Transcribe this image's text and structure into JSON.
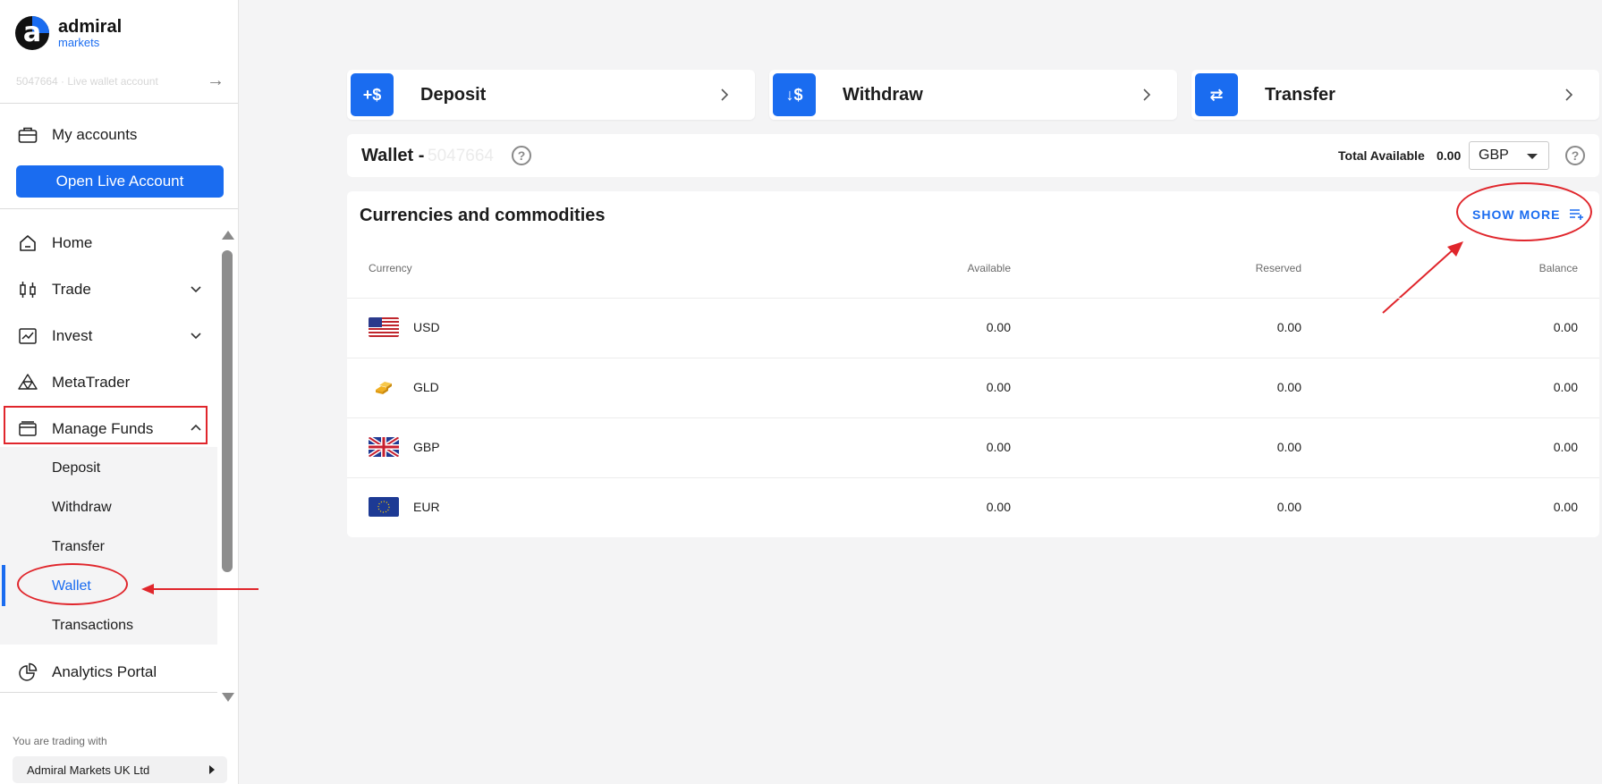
{
  "sidebar": {
    "logo_brand": "admiral",
    "logo_sub": "markets",
    "account_line": "5047664 · Live wallet account",
    "my_accounts": "My accounts",
    "open_live_account": "Open Live Account",
    "nav": {
      "home": "Home",
      "trade": "Trade",
      "invest": "Invest",
      "metatrader": "MetaTrader",
      "manage_funds": "Manage Funds",
      "analytics_portal": "Analytics Portal"
    },
    "manage_funds_sub": {
      "deposit": "Deposit",
      "withdraw": "Withdraw",
      "transfer": "Transfer",
      "wallet": "Wallet",
      "transactions": "Transactions"
    },
    "trading_with_label": "You are trading with",
    "entity": "Admiral Markets UK Ltd"
  },
  "actions": {
    "deposit": {
      "label": "Deposit",
      "icon": "+$"
    },
    "withdraw": {
      "label": "Withdraw",
      "icon": "↓$"
    },
    "transfer": {
      "label": "Transfer",
      "icon": "⇄"
    }
  },
  "wallet": {
    "title": "Wallet -",
    "id": "5047664",
    "total_label": "Total Available",
    "total_value": "0.00",
    "currency": "GBP"
  },
  "currencies": {
    "title": "Currencies and commodities",
    "show_more": "SHOW MORE",
    "columns": {
      "currency": "Currency",
      "available": "Available",
      "reserved": "Reserved",
      "balance": "Balance"
    },
    "rows": [
      {
        "code": "USD",
        "available": "0.00",
        "reserved": "0.00",
        "balance": "0.00",
        "flag": "us-flag"
      },
      {
        "code": "GLD",
        "available": "0.00",
        "reserved": "0.00",
        "balance": "0.00",
        "flag": "gold-icon"
      },
      {
        "code": "GBP",
        "available": "0.00",
        "reserved": "0.00",
        "balance": "0.00",
        "flag": "uk-flag"
      },
      {
        "code": "EUR",
        "available": "0.00",
        "reserved": "0.00",
        "balance": "0.00",
        "flag": "eu-flag"
      }
    ]
  },
  "colors": {
    "accent": "#1a6cf0",
    "annotation": "#e0262c",
    "page_bg": "#f4f4f5"
  }
}
